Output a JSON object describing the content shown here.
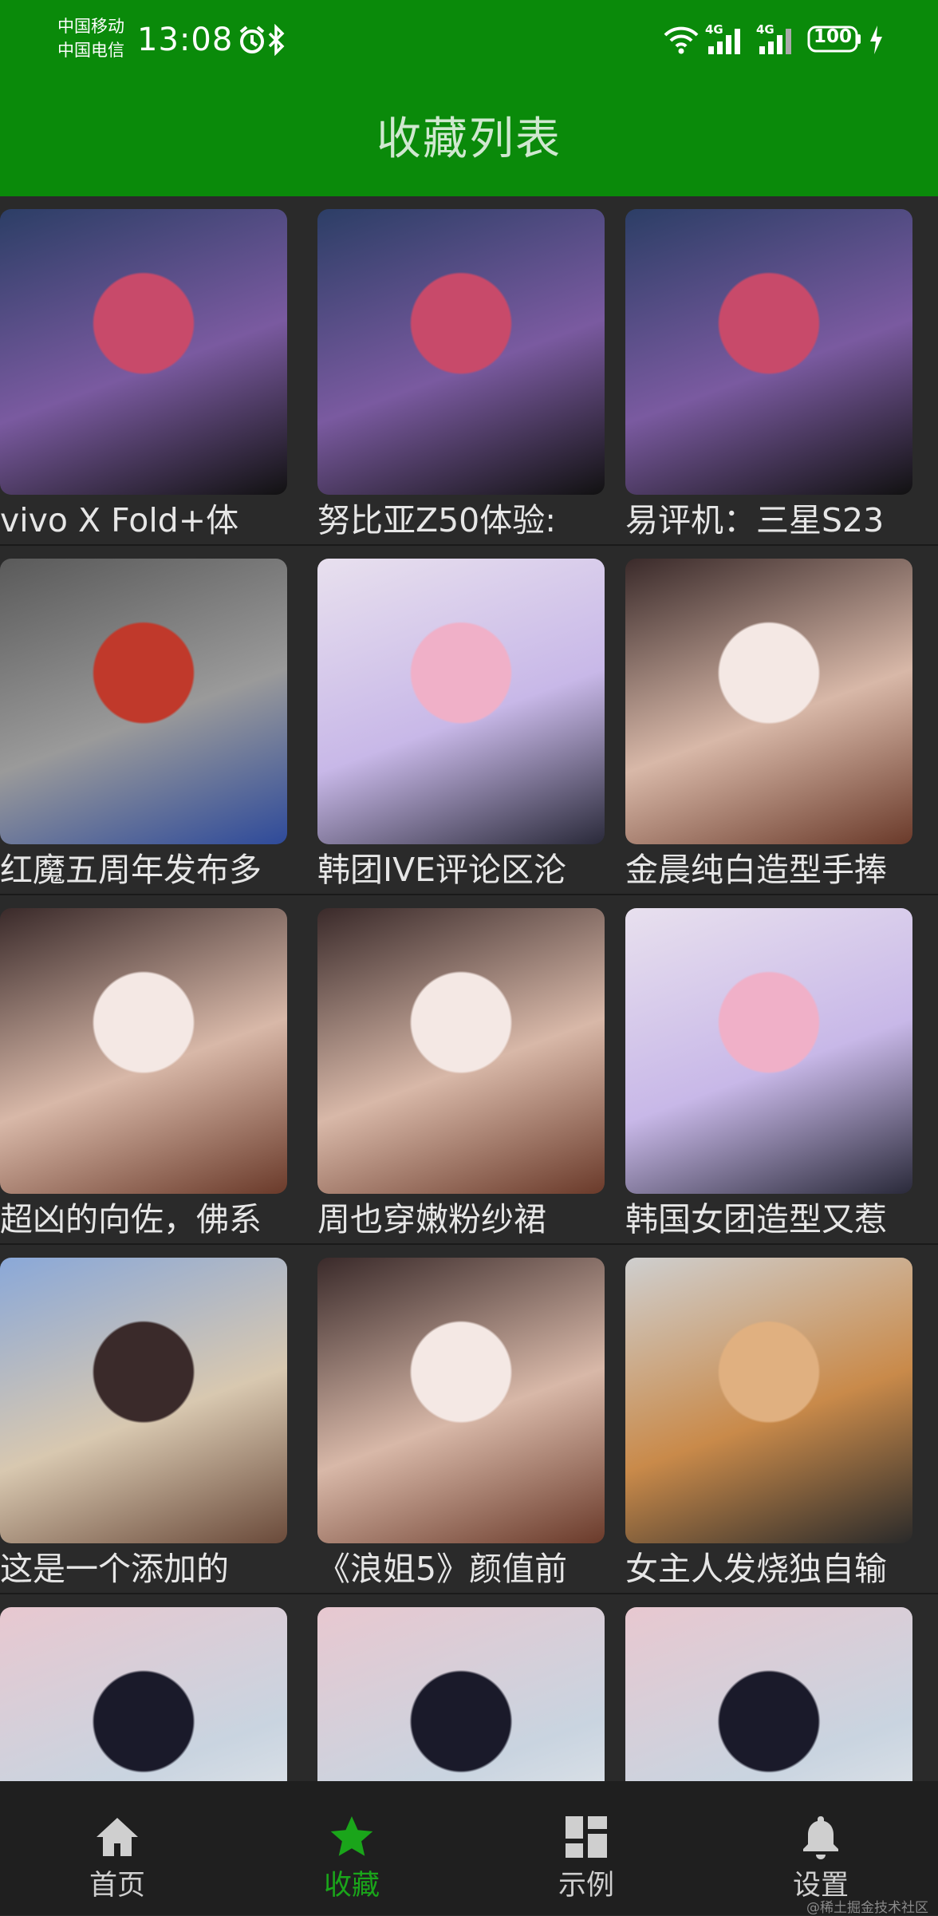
{
  "status_bar": {
    "carrier_1": "中国移动",
    "carrier_2": "中国电信",
    "time": "13:08",
    "network_1": "4G",
    "network_2": "4G",
    "battery": "100"
  },
  "app_bar": {
    "title": "收藏列表"
  },
  "colors": {
    "app_bar": "#0a8a0a",
    "active_tab": "#1aa51a",
    "background": "#2a2a2a",
    "nav_background": "#1f1f1f"
  },
  "favorites": {
    "items": [
      {
        "caption": "vivo X Fold+体",
        "thumb": "phone-photo"
      },
      {
        "caption": "努比亚Z50体验:",
        "thumb": "phone-photo"
      },
      {
        "caption": "易评机：三星S23",
        "thumb": "phone-photo"
      },
      {
        "caption": "红魔五周年发布多",
        "thumb": "product-photo"
      },
      {
        "caption": "韩团IVE评论区沦",
        "thumb": "group-photo"
      },
      {
        "caption": "金晨纯白造型手捧",
        "thumb": "portrait-photo"
      },
      {
        "caption": "超凶的向佐，佛系",
        "thumb": "portrait-photo"
      },
      {
        "caption": "周也穿嫩粉纱裙",
        "thumb": "portrait-photo"
      },
      {
        "caption": "韩国女团造型又惹",
        "thumb": "group-photo"
      },
      {
        "caption": "这是一个添加的",
        "thumb": "couple-photo"
      },
      {
        "caption": "《浪姐5》颜值前",
        "thumb": "portrait-photo"
      },
      {
        "caption": "女主人发烧独自输",
        "thumb": "dog-photo"
      },
      {
        "caption": "",
        "thumb": "fashion-photo"
      },
      {
        "caption": "",
        "thumb": "fashion-photo"
      },
      {
        "caption": "",
        "thumb": "fashion-photo"
      }
    ]
  },
  "bottom_nav": {
    "items": [
      {
        "label": "首页",
        "icon": "home-icon"
      },
      {
        "label": "收藏",
        "icon": "star-icon"
      },
      {
        "label": "示例",
        "icon": "dashboard-icon"
      },
      {
        "label": "设置",
        "icon": "bell-icon"
      }
    ],
    "active_index": 1
  },
  "watermark": "@稀土掘金技术社区"
}
